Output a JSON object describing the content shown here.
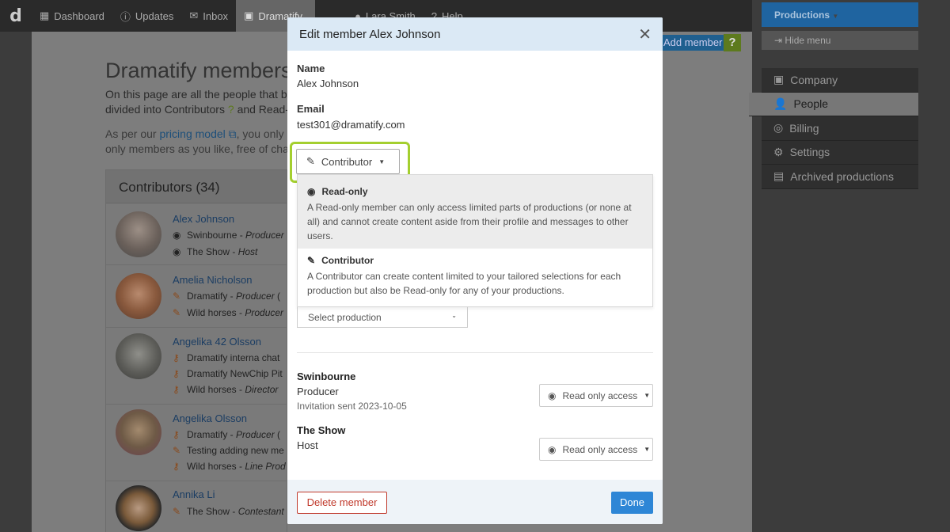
{
  "nav": {
    "logo": "d",
    "items": [
      {
        "label": "Dashboard",
        "icon": "dashboard-icon"
      },
      {
        "label": "Updates",
        "icon": "info-icon"
      },
      {
        "label": "Inbox",
        "icon": "inbox-icon"
      },
      {
        "label": "Dramatify",
        "icon": "briefcase-icon"
      },
      {
        "label": "Lara Smith",
        "icon": "user-icon"
      },
      {
        "label": "Help",
        "icon": "help-icon"
      }
    ]
  },
  "page": {
    "title": "Dramatify members",
    "intro_line1": "On this page are all the people that bel",
    "intro_line2": "divided into Contributors",
    "intro_line2b": "and Read-o",
    "intro2_line1a": "As per our",
    "intro2_link": "pricing model",
    "intro2_line1b": ", you only pa",
    "intro2_line2": "only members as you like, free of charge",
    "add_member": "Add member",
    "help": "?",
    "contributors_heading": "Contributors (34)",
    "members": [
      {
        "name": "Alex Johnson",
        "lines": [
          {
            "icon": "eye",
            "prod": "Swinbourne",
            "role": "Producer"
          },
          {
            "icon": "eye",
            "prod": "The Show",
            "role": "Host"
          }
        ]
      },
      {
        "name": "Amelia Nicholson",
        "lines": [
          {
            "icon": "pen",
            "prod": "Dramatify",
            "role": "Producer"
          },
          {
            "icon": "pen",
            "prod": "Wild horses",
            "role": "Producer"
          }
        ]
      },
      {
        "name": "Angelika 42 Olsson",
        "lines": [
          {
            "icon": "key",
            "prod": "Dramatify interna chat",
            "role": ""
          },
          {
            "icon": "key",
            "prod": "Dramatify NewChip Pit",
            "role": ""
          },
          {
            "icon": "key",
            "prod": "Wild horses",
            "role": "Director"
          }
        ]
      },
      {
        "name": "Angelika Olsson",
        "lines": [
          {
            "icon": "key",
            "prod": "Dramatify",
            "role": "Producer"
          },
          {
            "icon": "pen",
            "prod": "Testing adding new me",
            "role": ""
          },
          {
            "icon": "key",
            "prod": "Wild horses",
            "role": "Line Prod"
          }
        ]
      },
      {
        "name": "Annika Li",
        "lines": [
          {
            "icon": "pen",
            "prod": "The Show",
            "role": "Contestant"
          }
        ]
      }
    ]
  },
  "sidebar": {
    "productions": "Productions",
    "hide_menu": "Hide menu",
    "items": [
      {
        "label": "Company",
        "icon": "briefcase-icon"
      },
      {
        "label": "People",
        "icon": "people-icon"
      },
      {
        "label": "Billing",
        "icon": "coins-icon"
      },
      {
        "label": "Settings",
        "icon": "gear-icon"
      },
      {
        "label": "Archived productions",
        "icon": "archive-icon"
      }
    ]
  },
  "modal": {
    "title": "Edit member Alex Johnson",
    "name_label": "Name",
    "name_value": "Alex Johnson",
    "email_label": "Email",
    "email_value": "test301@dramatify.com",
    "role_selected": "Contributor",
    "role_options": [
      {
        "title": "Read-only",
        "desc": "A Read-only member can only access limited parts of productions (or none at all) and cannot create content aside from their profile and messages to other users."
      },
      {
        "title": "Contributor",
        "desc": "A Contributor can create content limited to your tailored selections for each production but also be Read-only for any of your productions."
      }
    ],
    "select_production": "Select production",
    "productions": [
      {
        "name": "Swinbourne",
        "role": "Producer",
        "invite": "Invitation sent 2023-10-05",
        "access": "Read only access"
      },
      {
        "name": "The Show",
        "role": "Host",
        "invite": "",
        "access": "Read only access"
      }
    ],
    "delete_label": "Delete member",
    "done_label": "Done"
  },
  "colors": {
    "highlight": "#a4cf2f",
    "primary": "#2e86d6",
    "danger": "#c0392b",
    "modal_header": "#dbe9f5"
  }
}
